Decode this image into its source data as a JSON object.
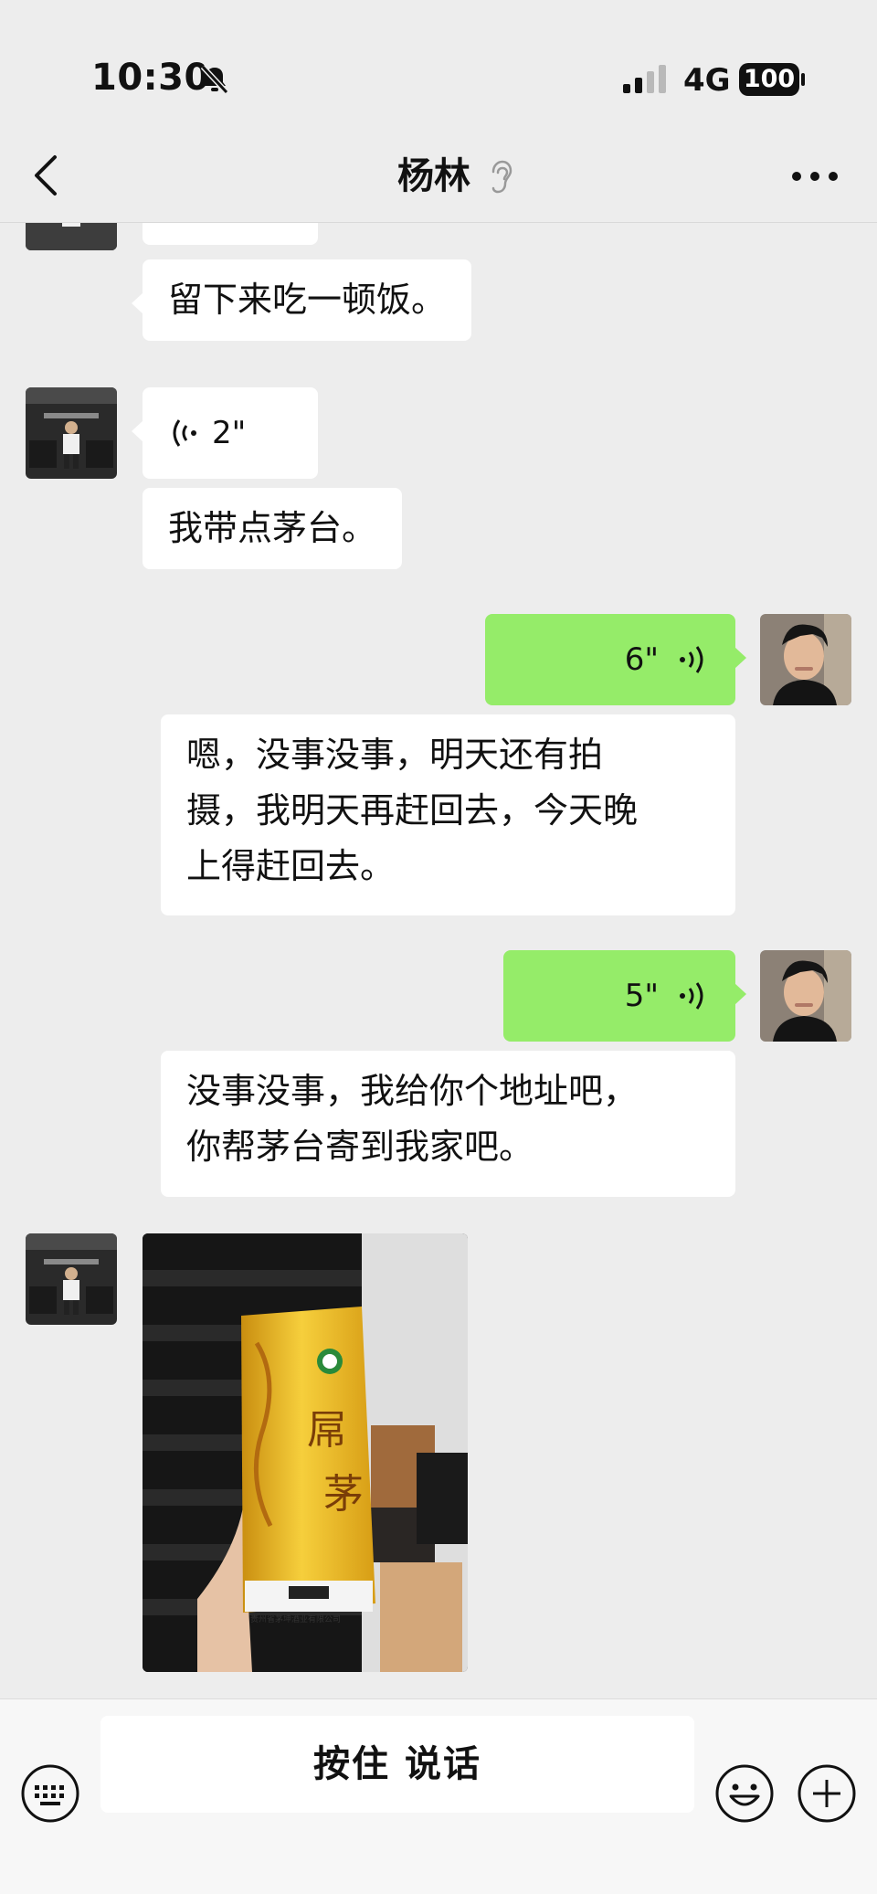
{
  "status_bar": {
    "time": "10:30",
    "network": "4G",
    "battery": "100"
  },
  "nav": {
    "title": "杨林"
  },
  "messages": [
    {
      "side": "left",
      "type": "text",
      "text": "留下来吃一顿饭。"
    },
    {
      "side": "left",
      "type": "voice",
      "duration": "2\""
    },
    {
      "side": "left",
      "type": "text",
      "text": "我带点茅台。"
    },
    {
      "side": "right",
      "type": "voice",
      "duration": "6\""
    },
    {
      "side": "right",
      "type": "transcript",
      "lines": [
        "嗯，没事没事，明天还有拍",
        "摄，我明天再赶回去，今天晚",
        "上得赶回去。"
      ]
    },
    {
      "side": "right",
      "type": "voice",
      "duration": "5\""
    },
    {
      "side": "right",
      "type": "transcript",
      "lines": [
        "没事没事，我给你个地址吧，",
        "你帮茅台寄到我家吧。"
      ]
    },
    {
      "side": "left",
      "type": "image",
      "image": {
        "bottle_characters": [
          "屌",
          "茅"
        ],
        "bottle_footer": "贵州省茅坤酒业有限公司"
      }
    }
  ],
  "input_bar": {
    "talk_label": "按住 说话"
  },
  "colors": {
    "background": "#ededed",
    "sent_bubble": "#95ec69",
    "received_bubble": "#ffffff"
  },
  "icons": [
    "bell-slash-icon",
    "signal-icon",
    "battery-icon",
    "back-icon",
    "ear-icon",
    "more-icon",
    "voice-wave-icon",
    "keyboard-icon",
    "emoji-icon",
    "plus-icon"
  ]
}
